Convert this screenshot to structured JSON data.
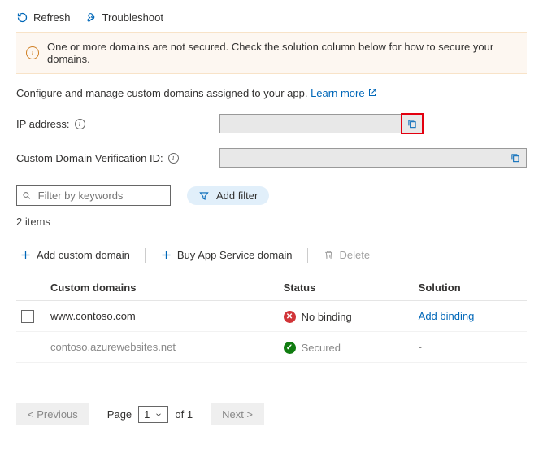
{
  "toolbar": {
    "refresh": "Refresh",
    "troubleshoot": "Troubleshoot"
  },
  "warning": "One or more domains are not secured. Check the solution column below for how to secure your domains.",
  "description": "Configure and manage custom domains assigned to your app.",
  "learn_more": "Learn more",
  "fields": {
    "ip_label": "IP address:",
    "ip_value": "",
    "verification_label": "Custom Domain Verification ID:",
    "verification_value": ""
  },
  "filter": {
    "placeholder": "Filter by keywords",
    "add_filter": "Add filter"
  },
  "items_count": "2 items",
  "actions": {
    "add_custom_domain": "Add custom domain",
    "buy_domain": "Buy App Service domain",
    "delete": "Delete"
  },
  "columns": {
    "domains": "Custom domains",
    "status": "Status",
    "solution": "Solution"
  },
  "rows": [
    {
      "domain": "www.contoso.com",
      "status_text": "No binding",
      "status_kind": "err",
      "solution": "Add binding",
      "solution_link": true,
      "selectable": true
    },
    {
      "domain": "contoso.azurewebsites.net",
      "status_text": "Secured",
      "status_kind": "ok",
      "solution": "-",
      "solution_link": false,
      "selectable": false
    }
  ],
  "pager": {
    "prev": "< Previous",
    "page_label": "Page",
    "page_value": "1",
    "of_label": "of 1",
    "next": "Next >"
  }
}
